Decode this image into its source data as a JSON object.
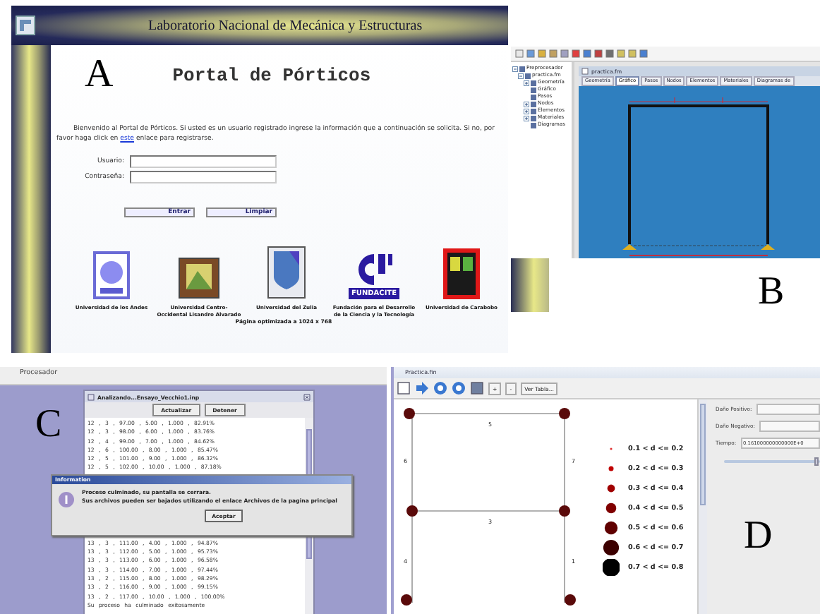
{
  "panel_a": {
    "label": "A",
    "header_title": "Laboratorio Nacional de Mecánica y Estructuras",
    "heading": "Portal de Pórticos",
    "intro_before_link": "Bienvenido al Portal de Pórticos. Si usted es un usuario registrado ingrese la información que a continuación se solicita. Si no, por favor haga click en",
    "intro_link": "este",
    "intro_after_link": "enlace para registrarse.",
    "fields": [
      {
        "label": "Usuario:"
      },
      {
        "label": "Contraseña:"
      }
    ],
    "buttons": [
      "Entrar",
      "Limpiar"
    ],
    "logos": [
      {
        "kind": "seal",
        "caption": "Universidad de los Andes"
      },
      {
        "kind": "painting",
        "caption": "Universidad Centro-Occidental Lisandro Alvarado"
      },
      {
        "kind": "shield",
        "caption": "Universidad del Zulia"
      },
      {
        "kind": "letters",
        "text": "FUNDACITE",
        "caption": "Fundación para el Desarrollo de la Ciencia y la Tecnología"
      },
      {
        "kind": "crest",
        "caption": "Universidad de Carabobo"
      }
    ],
    "footer": "Página optimizada a 1024 x 768"
  },
  "panel_b": {
    "label": "B",
    "tree": {
      "label": "Preprocesador",
      "expanded": true,
      "children": [
        {
          "label": "practica.fm",
          "expanded": true,
          "children": [
            {
              "label": "Geometría",
              "expanded": false
            },
            {
              "label": "Gráfico"
            },
            {
              "label": "Pasos"
            },
            {
              "label": "Nodos",
              "expanded": false
            },
            {
              "label": "Elementos",
              "expanded": false
            },
            {
              "label": "Materiales",
              "expanded": false
            },
            {
              "label": "Diagramas"
            }
          ]
        }
      ]
    },
    "document_title": "practica.fm",
    "tabs": [
      {
        "label": "Geometría",
        "selected": false
      },
      {
        "label": "Gráfico",
        "selected": true
      },
      {
        "label": "Pasos",
        "selected": false
      },
      {
        "label": "Nodos",
        "selected": false
      },
      {
        "label": "Elementos",
        "selected": false
      },
      {
        "label": "Materiales",
        "selected": false
      },
      {
        "label": "Diagramas de",
        "selected": false
      }
    ]
  },
  "panel_c": {
    "label": "C",
    "window_title": "Procesador",
    "inner_title": "Analizando...Ensayo_Vecchio1.inp",
    "buttons": [
      "Actualizar",
      "Detener"
    ],
    "rows_before": [
      "12 , 3 , 97.00 , 5.00 , 1.000 , 82.91%",
      "12 , 3 , 98.00 , 6.00 , 1.000 , 83.76%",
      "12 , 4 , 99.00 , 7.00 , 1.000 , 84.62%",
      "12 , 6 , 100.00 , 8.00 , 1.000 , 85.47%",
      "12 , 5 , 101.00 , 9.00 , 1.000 , 86.32%",
      "12 , 5 , 102.00 , 10.00 , 1.000 , 87.18%"
    ],
    "rows_after": [
      "13 , 3 , 111.00 , 4.00 , 1.000 , 94.87%",
      "13 , 3 , 112.00 , 5.00 , 1.000 , 95.73%",
      "13 , 3 , 113.00 , 6.00 , 1.000 , 96.58%",
      "13 , 3 , 114.00 , 7.00 , 1.000 , 97.44%",
      "13 , 2 , 115.00 , 8.00 , 1.000 , 98.29%",
      "13 , 2 , 116.00 , 9.00 , 1.000 , 99.15%",
      "13 , 2 , 117.00 , 10.00 , 1.000 , 100.00%"
    ],
    "status": "Su proceso ha culminado exitosamente",
    "dialog": {
      "title": "Information",
      "lines": [
        "Proceso culminado, su pantalla se cerrara.",
        "Sus archivos pueden ser bajados utilizando el enlace Archivos de la pagina principal"
      ],
      "button": "Aceptar"
    }
  },
  "panel_d": {
    "label": "D",
    "window_title": "Practica.fin",
    "toolbar_buttons": [
      "+",
      "-",
      "Ver Tabla..."
    ],
    "element_labels": [
      "5",
      "6",
      "7",
      "3",
      "4",
      "1"
    ],
    "legend": [
      {
        "label": "0.1 < d <= 0.2",
        "color": "#e03030"
      },
      {
        "label": "0.2 < d <= 0.3",
        "color": "#c00000"
      },
      {
        "label": "0.3 < d <= 0.4",
        "color": "#a00000"
      },
      {
        "label": "0.4 < d <= 0.5",
        "color": "#800000"
      },
      {
        "label": "0.5 < d <= 0.6",
        "color": "#600000"
      },
      {
        "label": "0.6 < d <= 0.7",
        "color": "#3c0000"
      },
      {
        "label": "0.7 < d <= 0.8",
        "color": "#000000"
      }
    ],
    "fields": [
      {
        "label": "Daño Positivo:"
      },
      {
        "label": "Daño Negativo:"
      },
      {
        "label": "Tiempo:",
        "value": "0.161000000000000E+0"
      }
    ],
    "slider": {
      "level": 0.97
    }
  }
}
